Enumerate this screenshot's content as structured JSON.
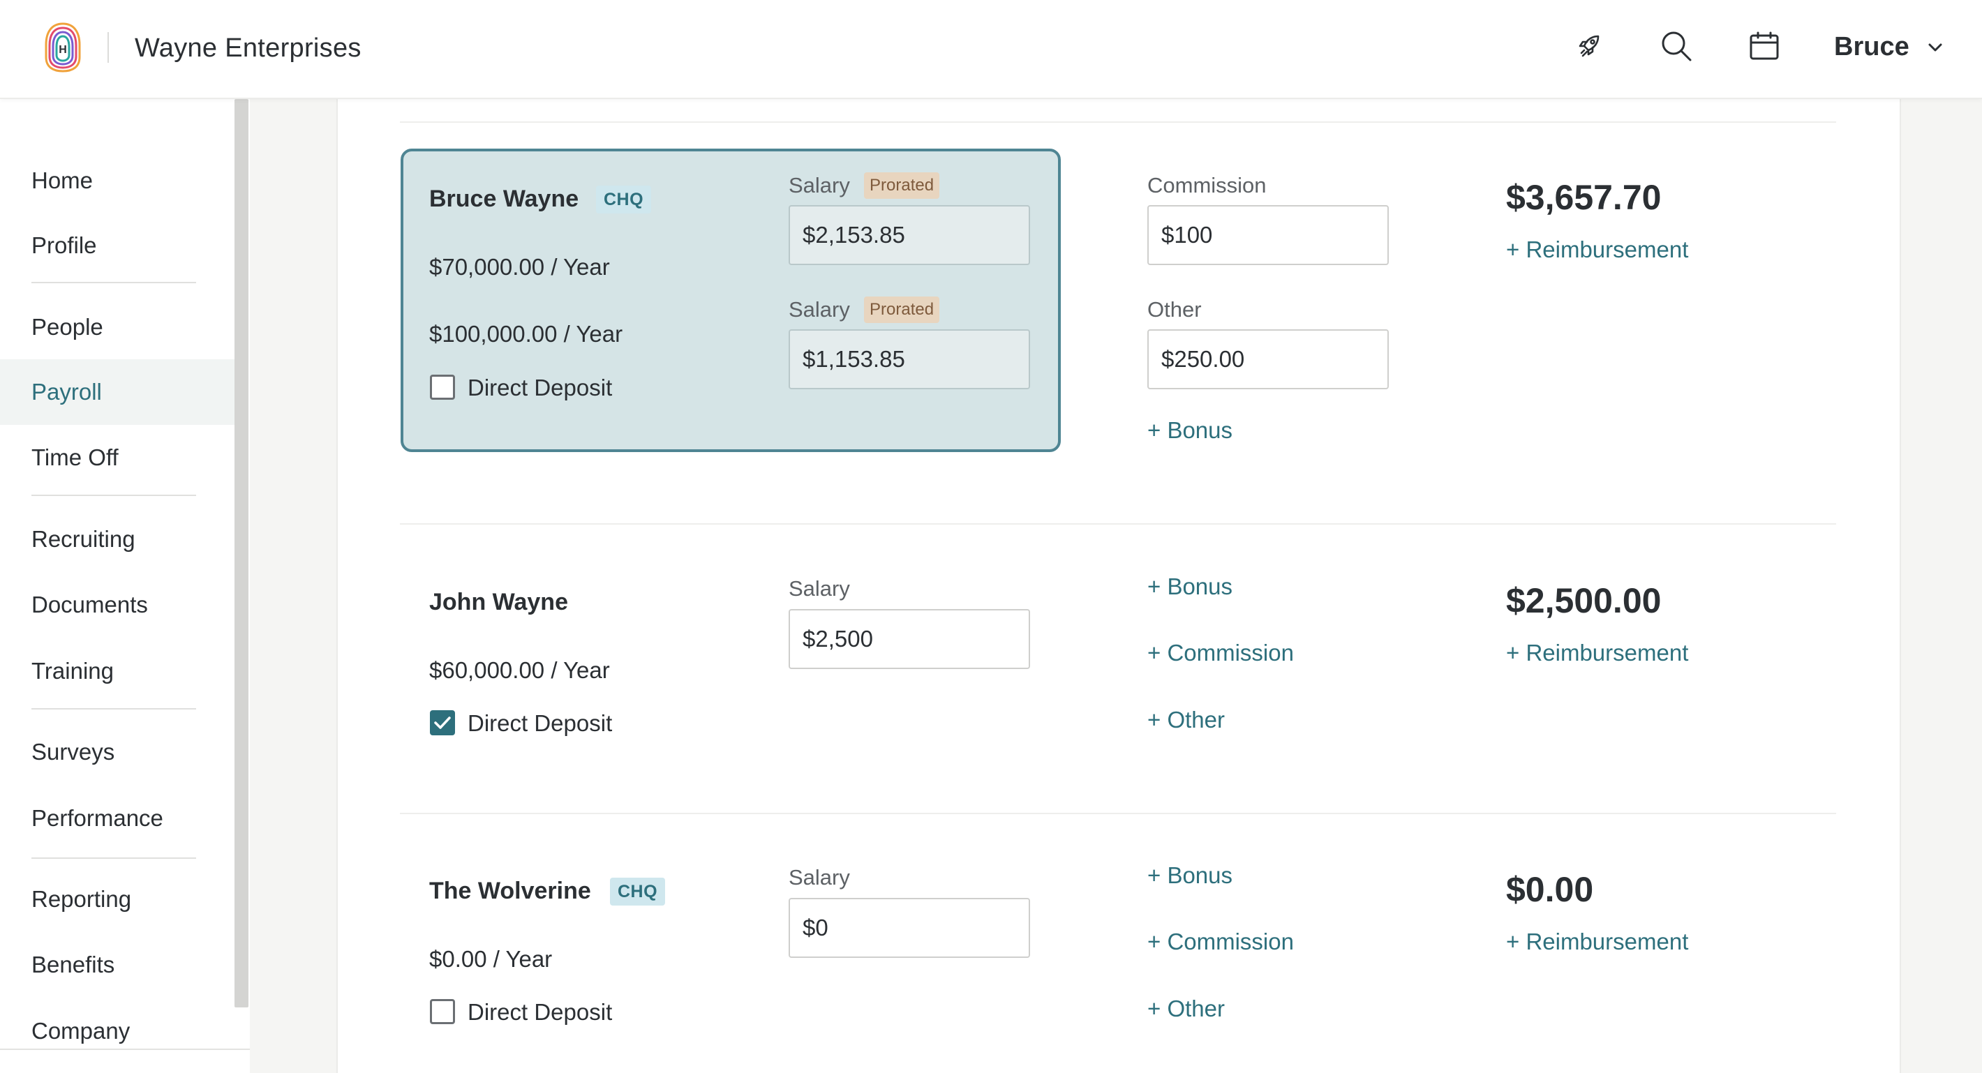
{
  "header": {
    "company": "Wayne Enterprises",
    "logo_letter": "H",
    "user": "Bruce",
    "icons": [
      "rocket-icon",
      "search-icon",
      "calendar-icon",
      "chevron-down-icon"
    ]
  },
  "sidebar": {
    "items": [
      {
        "label": "Home",
        "active": false
      },
      {
        "label": "Profile",
        "active": false
      },
      {
        "label": "People",
        "active": false
      },
      {
        "label": "Payroll",
        "active": true
      },
      {
        "label": "Time Off",
        "active": false
      },
      {
        "label": "Recruiting",
        "active": false
      },
      {
        "label": "Documents",
        "active": false
      },
      {
        "label": "Training",
        "active": false
      },
      {
        "label": "Surveys",
        "active": false
      },
      {
        "label": "Performance",
        "active": false
      },
      {
        "label": "Reporting",
        "active": false
      },
      {
        "label": "Benefits",
        "active": false
      },
      {
        "label": "Company",
        "active": false
      }
    ]
  },
  "employees": [
    {
      "name": "Bruce Wayne",
      "badge": "CHQ",
      "rates": [
        "$70,000.00 / Year",
        "$100,000.00 / Year"
      ],
      "direct_deposit_label": "Direct Deposit",
      "direct_deposit": false,
      "salary_label": "Salary",
      "prorated_label": "Prorated",
      "salaries": [
        "$2,153.85",
        "$1,153.85"
      ],
      "commission_label": "Commission",
      "commission": "$100",
      "other_label": "Other",
      "other": "$250.00",
      "bonus_link": "+ Bonus",
      "total": "$3,657.70",
      "reimbursement_link": "+ Reimbursement"
    },
    {
      "name": "John Wayne",
      "rate": "$60,000.00 / Year",
      "direct_deposit_label": "Direct Deposit",
      "direct_deposit": true,
      "salary_label": "Salary",
      "salary": "$2,500",
      "bonus_link": "+ Bonus",
      "commission_link": "+ Commission",
      "other_link": "+ Other",
      "total": "$2,500.00",
      "reimbursement_link": "+ Reimbursement"
    },
    {
      "name": "The Wolverine",
      "badge": "CHQ",
      "rate": "$0.00 / Year",
      "direct_deposit_label": "Direct Deposit",
      "direct_deposit": false,
      "salary_label": "Salary",
      "salary": "$0",
      "bonus_link": "+ Bonus",
      "commission_link": "+ Commission",
      "other_link": "+ Other",
      "total": "$0.00",
      "reimbursement_link": "+ Reimbursement"
    }
  ],
  "colors": {
    "accent": "#2d6f7c",
    "highlight_bg": "#d5e4e6",
    "highlight_border": "#4f8593",
    "prorated_bg": "#e8d5bf",
    "chq_bg": "#cfe7ee"
  }
}
